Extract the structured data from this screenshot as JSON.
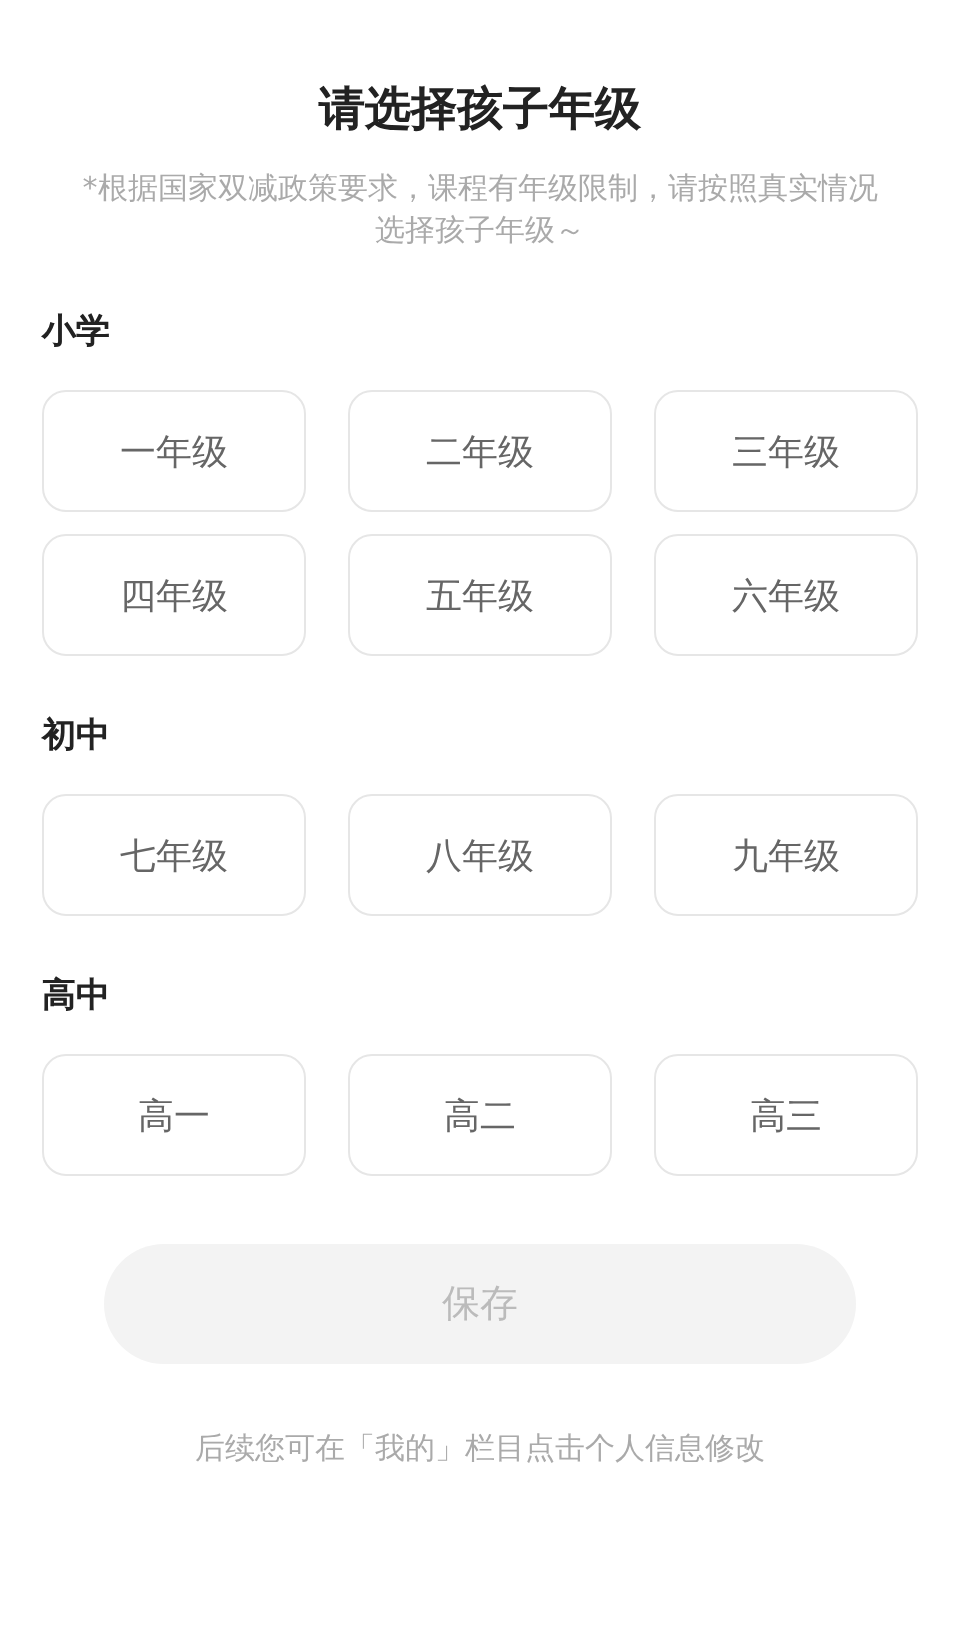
{
  "title": "请选择孩子年级",
  "notice": "*根据国家双减政策要求，课程有年级限制，请按照真实情况选择孩子年级～",
  "sections": [
    {
      "label": "小学",
      "grades": [
        {
          "label": "一年级",
          "selected": false
        },
        {
          "label": "二年级",
          "selected": false
        },
        {
          "label": "三年级",
          "selected": false
        },
        {
          "label": "四年级",
          "selected": false
        },
        {
          "label": "五年级",
          "selected": false
        },
        {
          "label": "六年级",
          "selected": false
        }
      ]
    },
    {
      "label": "初中",
      "grades": [
        {
          "label": "七年级",
          "selected": false
        },
        {
          "label": "八年级",
          "selected": false
        },
        {
          "label": "九年级",
          "selected": false
        }
      ]
    },
    {
      "label": "高中",
      "grades": [
        {
          "label": "高一",
          "selected": false
        },
        {
          "label": "高二",
          "selected": false
        },
        {
          "label": "高三",
          "selected": false
        }
      ]
    }
  ],
  "save_button": {
    "label": "保存",
    "disabled": true
  },
  "footer": "后续您可在「我的」栏目点击个人信息修改"
}
